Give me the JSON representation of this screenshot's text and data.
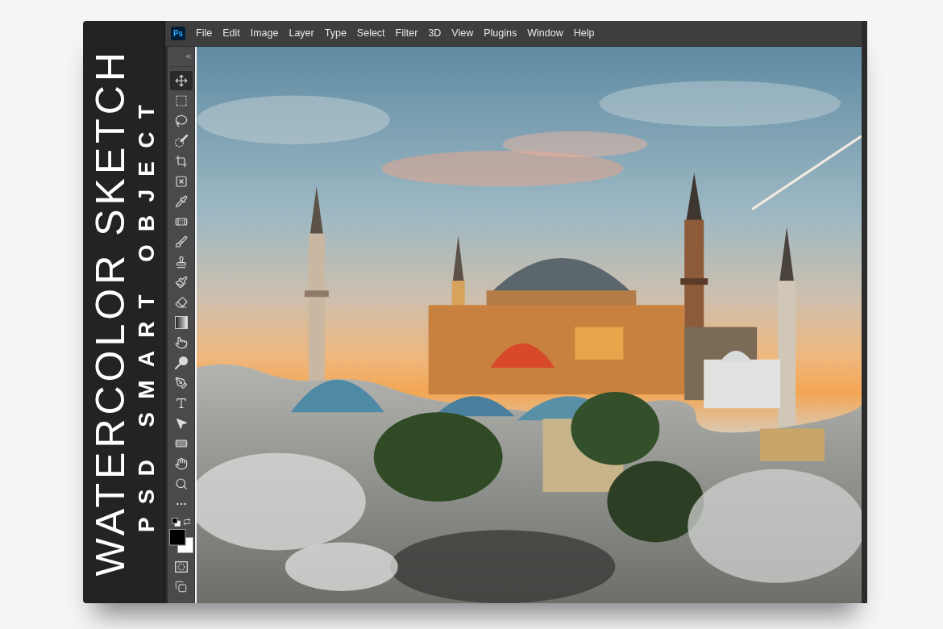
{
  "spine": {
    "title": "WATERCOLOR SKETCH",
    "subtitle": "PSD SMART OBJECT"
  },
  "menu_bar": {
    "logo": "Ps",
    "items": [
      "File",
      "Edit",
      "Image",
      "Layer",
      "Type",
      "Select",
      "Filter",
      "3D",
      "View",
      "Plugins",
      "Window",
      "Help"
    ]
  },
  "toolbar": {
    "tools": [
      {
        "kind": "move",
        "selected": true
      },
      {
        "kind": "marquee",
        "selected": false
      },
      {
        "kind": "lasso",
        "selected": false
      },
      {
        "kind": "quick-select",
        "selected": false
      },
      {
        "kind": "crop",
        "selected": false
      },
      {
        "kind": "frame",
        "selected": false
      },
      {
        "kind": "eyedropper",
        "selected": false
      },
      {
        "kind": "healing",
        "selected": false
      },
      {
        "kind": "brush",
        "selected": false
      },
      {
        "kind": "stamp",
        "selected": false
      },
      {
        "kind": "history-brush",
        "selected": false
      },
      {
        "kind": "eraser",
        "selected": false
      },
      {
        "kind": "gradient",
        "selected": false
      },
      {
        "kind": "smudge",
        "selected": false
      },
      {
        "kind": "dodge",
        "selected": false
      },
      {
        "kind": "pen",
        "selected": false
      },
      {
        "kind": "type",
        "selected": false
      },
      {
        "kind": "path-select",
        "selected": false
      },
      {
        "kind": "rectangle",
        "selected": false
      },
      {
        "kind": "hand",
        "selected": false
      },
      {
        "kind": "zoom",
        "selected": false
      },
      {
        "kind": "more",
        "selected": false
      }
    ],
    "swatches": [
      {
        "kind": "foreground",
        "color": "#000000"
      },
      {
        "kind": "background",
        "color": "#ffffff"
      }
    ]
  }
}
